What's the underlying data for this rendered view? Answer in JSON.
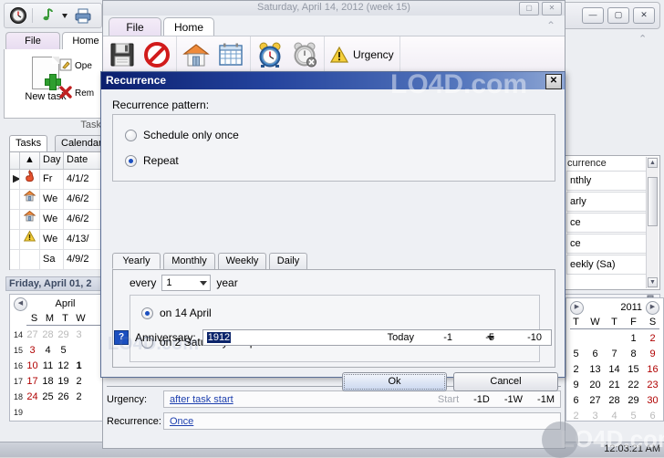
{
  "main_window": {
    "mini_toolbar": {
      "icons": [
        "clock-icon",
        "music-note-icon",
        "dropdown-arrow-icon",
        "printer-icon"
      ]
    },
    "ribbon_tabs": [
      {
        "label": "File",
        "selected": false
      },
      {
        "label": "Home",
        "selected": true
      }
    ],
    "ribbon": {
      "new_task_label": "New task",
      "open_label": "Ope",
      "remove_label": "Rem",
      "group_caption": "Task"
    },
    "panel_tabs": [
      {
        "label": "Tasks",
        "selected": true
      },
      {
        "label": "Calendar",
        "selected": false
      }
    ],
    "grid": {
      "headers": [
        "",
        "",
        "Day",
        "Date"
      ],
      "rows": [
        {
          "marker": "▶",
          "icon": "flame-icon",
          "day": "Fr",
          "date": "4/1/2"
        },
        {
          "marker": "",
          "icon": "house-icon",
          "day": "We",
          "date": "4/6/2"
        },
        {
          "marker": "",
          "icon": "house-icon",
          "day": "We",
          "date": "4/6/2"
        },
        {
          "marker": "",
          "icon": "warning-icon",
          "day": "We",
          "date": "4/13/"
        },
        {
          "marker": "",
          "icon": "",
          "day": "Sa",
          "date": "4/9/2"
        }
      ]
    },
    "date_header": "Friday, April 01, 2",
    "calendar_left": {
      "month": "April",
      "dow": [
        "S",
        "M",
        "T",
        "W"
      ],
      "weeks": [
        {
          "num": "14",
          "days": [
            "27",
            "28",
            "29",
            "3"
          ],
          "dim": [
            true,
            true,
            true,
            true
          ]
        },
        {
          "num": "15",
          "days": [
            "3",
            "4",
            "5",
            ""
          ],
          "dim": [
            false,
            false,
            false,
            false
          ]
        },
        {
          "num": "16",
          "days": [
            "10",
            "11",
            "12",
            "1"
          ],
          "dim": [
            false,
            false,
            false,
            false
          ]
        },
        {
          "num": "17",
          "days": [
            "17",
            "18",
            "19",
            "2"
          ],
          "dim": [
            false,
            false,
            false,
            false
          ]
        },
        {
          "num": "18",
          "days": [
            "24",
            "25",
            "26",
            "2"
          ],
          "dim": [
            false,
            false,
            false,
            false
          ]
        },
        {
          "num": "19",
          "days": [
            "",
            "",
            "",
            ""
          ],
          "dim": [
            false,
            false,
            false,
            false
          ]
        }
      ]
    },
    "right_panel": {
      "window_buttons": [
        "minimize-icon",
        "maximize-icon",
        "close-icon"
      ],
      "list_header": "currence",
      "list_items": [
        "nthly",
        "arly",
        "ce",
        "ce",
        "eekly (Sa)"
      ],
      "pin_icon": "pushpin-icon"
    },
    "calendar_right": {
      "year": "2011",
      "dow": [
        "T",
        "W",
        "T",
        "F",
        "S"
      ],
      "weeks": [
        {
          "days": [
            "",
            "",
            "",
            "1",
            "2"
          ],
          "dim": [
            false,
            false,
            false,
            false,
            false
          ]
        },
        {
          "days": [
            "5",
            "6",
            "7",
            "8",
            "9"
          ],
          "dim": [
            false,
            false,
            false,
            false,
            false
          ]
        },
        {
          "days": [
            "2",
            "13",
            "14",
            "15",
            "16"
          ],
          "dim": [
            false,
            false,
            false,
            false,
            false
          ]
        },
        {
          "days": [
            "9",
            "20",
            "21",
            "22",
            "23"
          ],
          "dim": [
            false,
            false,
            false,
            false,
            false
          ]
        },
        {
          "days": [
            "6",
            "27",
            "28",
            "29",
            "30"
          ],
          "dim": [
            false,
            false,
            false,
            false,
            false
          ]
        },
        {
          "days": [
            "2",
            "3",
            "4",
            "5",
            "6"
          ],
          "dim": [
            true,
            true,
            true,
            true,
            true
          ]
        }
      ]
    },
    "clock": "12:03:21 AM"
  },
  "task_window": {
    "title": "Saturday, April 14, 2012 (week 15)",
    "window_buttons": [
      "maximize-icon",
      "close-icon"
    ],
    "tabs": [
      {
        "label": "File",
        "selected": false
      },
      {
        "label": "Home",
        "selected": true
      }
    ],
    "ribbon_groups": [
      {
        "items": [
          {
            "name": "save-icon",
            "label": ""
          },
          {
            "name": "cancel-icon",
            "label": ""
          }
        ]
      },
      {
        "items": [
          {
            "name": "home-icon",
            "label": ""
          },
          {
            "name": "calendar-icon",
            "label": ""
          }
        ]
      },
      {
        "items": [
          {
            "name": "alarm-clock-icon",
            "label": ""
          },
          {
            "name": "alarm-off-icon",
            "label": ""
          }
        ]
      },
      {
        "items": [
          {
            "name": "urgency-warning-icon",
            "label": "Urgency"
          }
        ]
      }
    ],
    "form": {
      "urgency_label": "Urgency:",
      "urgency_value": "after task start",
      "urgency_quick": [
        "Start",
        "-1D",
        "-1W",
        "-1M"
      ],
      "recurrence_label": "Recurrence:",
      "recurrence_value": "Once"
    }
  },
  "dialog": {
    "title": "Recurrence",
    "close_label": "✕",
    "pattern_label": "Recurrence pattern:",
    "pattern_options": [
      {
        "label": "Schedule only once",
        "selected": false
      },
      {
        "label": "Repeat",
        "selected": true
      }
    ],
    "tabs": [
      {
        "label": "Yearly",
        "selected": true
      },
      {
        "label": "Monthly",
        "selected": false
      },
      {
        "label": "Weekly",
        "selected": false
      },
      {
        "label": "Daily",
        "selected": false
      }
    ],
    "yearly": {
      "every_label": "every",
      "interval_value": "1",
      "unit_label": "year",
      "options": [
        {
          "label": "on 14 April",
          "selected": true
        },
        {
          "label": "on 2 Saturday of April",
          "selected": false
        }
      ]
    },
    "anniversary": {
      "help_glyph": "?",
      "label": "Anniversary:",
      "value": "1912",
      "quick": [
        "Today",
        "-1",
        "-5",
        "-10"
      ]
    },
    "buttons": {
      "ok": "Ok",
      "cancel": "Cancel"
    }
  },
  "watermarks": {
    "top": "LO4D.com",
    "mid": "LO4D.com",
    "bottom": "LO4D.com"
  }
}
